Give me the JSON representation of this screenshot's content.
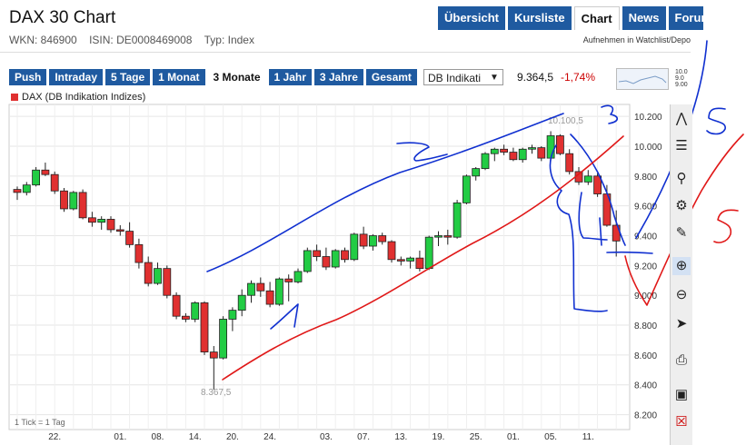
{
  "header": {
    "title": "DAX 30 Chart",
    "wkn": "WKN: 846900",
    "isin": "ISIN: DE0008469008",
    "typ": "Typ: Index",
    "watchlist": "Aufnehmen in Watchlist/Depo"
  },
  "tabs": [
    "Übersicht",
    "Kursliste",
    "Chart",
    "News",
    "Forum"
  ],
  "active_tab": "Chart",
  "ranges": [
    "Push",
    "Intraday",
    "5 Tage",
    "1 Monat",
    "3 Monate",
    "1 Jahr",
    "3 Jahre",
    "Gesamt"
  ],
  "active_range": "3 Monate",
  "exchange_select": "DB Indikati",
  "quote": {
    "price": "9.364,5",
    "change": "-1,74%"
  },
  "mini_chart_labels": [
    "10.0",
    "9.0",
    "9.00"
  ],
  "legend": "DAX (DB Indikation Indizes)",
  "footnote": "1 Tick = 1 Tag",
  "toolbar_icons": [
    "trend-line-icon",
    "ruler-icon",
    "search-icon",
    "settings-icon",
    "pencil-icon",
    "zoom-in-icon",
    "zoom-out-icon",
    "cursor-icon",
    "print-icon",
    "save-icon",
    "delete-icon"
  ],
  "colors": {
    "up": "#22cc44",
    "down": "#e03030",
    "tab": "#1f5aa0",
    "annotation_blue": "#1030d0",
    "annotation_red": "#e01818"
  },
  "chart_data": {
    "type": "candlestick",
    "series": [
      {
        "name": "DAX (DB Indikation Indizes)"
      }
    ],
    "ylim": [
      8100,
      10280
    ],
    "yticks": [
      "10.200",
      "10.000",
      "9.800",
      "9.600",
      "9.400",
      "9.200",
      "9.000",
      "8.800",
      "8.600",
      "8.400",
      "8.200"
    ],
    "ytick_values": [
      10200,
      10000,
      9800,
      9600,
      9400,
      9200,
      9000,
      8800,
      8600,
      8400,
      8200
    ],
    "xticks": [
      "22.",
      "01.",
      "08.",
      "14.",
      "20.",
      "24.",
      "03.",
      "07.",
      "13.",
      "19.",
      "25.",
      "01.",
      "05.",
      "11."
    ],
    "xtick_index": [
      4,
      11,
      15,
      19,
      23,
      27,
      33,
      37,
      41,
      45,
      49,
      53,
      57,
      61
    ],
    "annotations": {
      "high": "10.100,5",
      "low": "8.367,5"
    },
    "handwriting": [
      "2",
      "3",
      "4",
      "5",
      "5"
    ],
    "grid": true,
    "candles": [
      [
        9710,
        9730,
        9640,
        9690
      ],
      [
        9690,
        9760,
        9670,
        9740
      ],
      [
        9740,
        9860,
        9730,
        9840
      ],
      [
        9840,
        9890,
        9800,
        9810
      ],
      [
        9810,
        9830,
        9680,
        9700
      ],
      [
        9700,
        9720,
        9560,
        9580
      ],
      [
        9580,
        9700,
        9570,
        9690
      ],
      [
        9690,
        9710,
        9510,
        9520
      ],
      [
        9520,
        9560,
        9460,
        9490
      ],
      [
        9490,
        9530,
        9440,
        9510
      ],
      [
        9510,
        9530,
        9420,
        9440
      ],
      [
        9440,
        9470,
        9400,
        9430
      ],
      [
        9430,
        9490,
        9320,
        9340
      ],
      [
        9340,
        9380,
        9180,
        9220
      ],
      [
        9220,
        9260,
        9060,
        9080
      ],
      [
        9080,
        9220,
        9070,
        9180
      ],
      [
        9180,
        9200,
        8980,
        9000
      ],
      [
        9000,
        9020,
        8840,
        8860
      ],
      [
        8860,
        8880,
        8820,
        8840
      ],
      [
        8840,
        8960,
        8820,
        8950
      ],
      [
        8950,
        8960,
        8600,
        8620
      ],
      [
        8620,
        8660,
        8367.5,
        8580
      ],
      [
        8580,
        8860,
        8570,
        8840
      ],
      [
        8840,
        8920,
        8760,
        8900
      ],
      [
        8900,
        9040,
        8860,
        9000
      ],
      [
        9000,
        9100,
        8950,
        9080
      ],
      [
        9080,
        9120,
        8990,
        9030
      ],
      [
        9030,
        9090,
        8920,
        8940
      ],
      [
        8940,
        9120,
        8930,
        9110
      ],
      [
        9110,
        9140,
        8960,
        9090
      ],
      [
        9090,
        9180,
        9080,
        9160
      ],
      [
        9160,
        9320,
        9150,
        9300
      ],
      [
        9300,
        9340,
        9230,
        9260
      ],
      [
        9260,
        9320,
        9170,
        9190
      ],
      [
        9190,
        9310,
        9180,
        9300
      ],
      [
        9300,
        9320,
        9220,
        9240
      ],
      [
        9240,
        9420,
        9230,
        9410
      ],
      [
        9410,
        9460,
        9310,
        9330
      ],
      [
        9330,
        9410,
        9300,
        9400
      ],
      [
        9400,
        9420,
        9340,
        9360
      ],
      [
        9360,
        9370,
        9220,
        9240
      ],
      [
        9240,
        9260,
        9200,
        9230
      ],
      [
        9230,
        9260,
        9180,
        9250
      ],
      [
        9250,
        9300,
        9160,
        9180
      ],
      [
        9180,
        9400,
        9170,
        9390
      ],
      [
        9390,
        9430,
        9330,
        9400
      ],
      [
        9400,
        9440,
        9340,
        9390
      ],
      [
        9390,
        9640,
        9380,
        9620
      ],
      [
        9620,
        9810,
        9610,
        9800
      ],
      [
        9800,
        9860,
        9770,
        9850
      ],
      [
        9850,
        9960,
        9840,
        9950
      ],
      [
        9950,
        9990,
        9900,
        9980
      ],
      [
        9980,
        10010,
        9940,
        9960
      ],
      [
        9960,
        9990,
        9900,
        9910
      ],
      [
        9910,
        9990,
        9890,
        9980
      ],
      [
        9980,
        10010,
        9950,
        9990
      ],
      [
        9990,
        10000,
        9900,
        9920
      ],
      [
        9920,
        10100.5,
        9900,
        10070
      ],
      [
        10070,
        10080,
        9940,
        9950
      ],
      [
        9950,
        9980,
        9810,
        9830
      ],
      [
        9830,
        9860,
        9740,
        9760
      ],
      [
        9760,
        9840,
        9740,
        9800
      ],
      [
        9800,
        9820,
        9660,
        9680
      ],
      [
        9680,
        9740,
        9460,
        9470
      ],
      [
        9470,
        9570,
        9260,
        9364.5
      ]
    ]
  }
}
